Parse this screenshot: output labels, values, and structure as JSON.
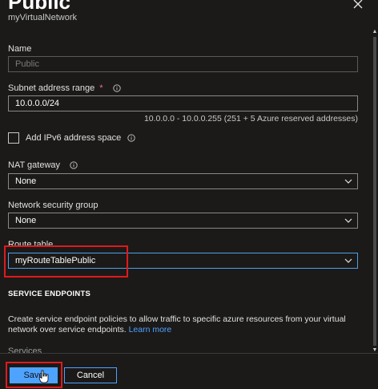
{
  "header": {
    "title": "Public",
    "subtitle": "myVirtualNetwork"
  },
  "icons": {
    "close": "close-icon",
    "info": "info-icon",
    "chevron": "chevron-down-icon",
    "cursor": "hand-pointer-icon"
  },
  "form": {
    "name": {
      "label": "Name",
      "value": "Public"
    },
    "subnet_range": {
      "label": "Subnet address range",
      "required_marker": "*",
      "value": "10.0.0.0/24",
      "hint": "10.0.0.0 - 10.0.0.255 (251 + 5 Azure reserved addresses)"
    },
    "ipv6": {
      "label": "Add IPv6 address space",
      "checked": false
    },
    "nat_gateway": {
      "label": "NAT gateway",
      "value": "None"
    },
    "nsg": {
      "label": "Network security group",
      "value": "None"
    },
    "route_table": {
      "label": "Route table",
      "value": "myRouteTablePublic"
    }
  },
  "service_endpoints": {
    "heading": "SERVICE ENDPOINTS",
    "description": "Create service endpoint policies to allow traffic to specific azure resources from your virtual network over service endpoints.",
    "link": "Learn more",
    "cutoff_label": "Services"
  },
  "footer": {
    "save_label": "Save",
    "cancel_label": "Cancel"
  },
  "colors": {
    "background": "#1b1a19",
    "accent": "#4ea3ff",
    "highlight": "#e0191c",
    "required": "#f1707b"
  }
}
